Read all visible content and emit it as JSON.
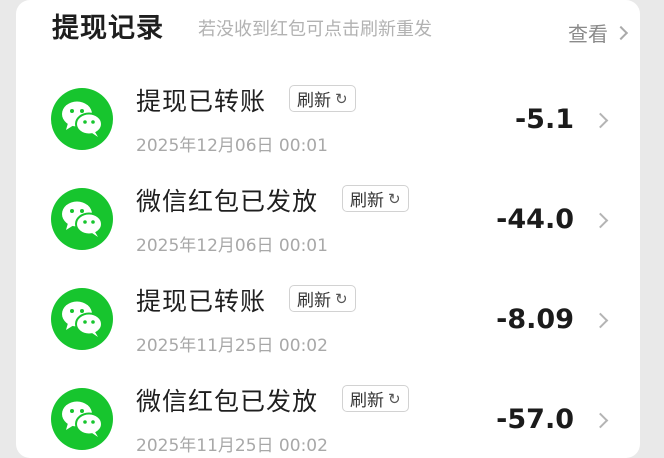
{
  "header": {
    "title": "提现记录",
    "subtitle": "若没收到红包可点击刷新重发",
    "view_label": "查看"
  },
  "records": [
    {
      "icon": "wechat-icon",
      "title": "提现已转账",
      "refresh_label": "刷新",
      "refresh_icon": "↻",
      "date": "2025年12月06日 00:01",
      "amount": "-5.1"
    },
    {
      "icon": "wechat-icon",
      "title": "微信红包已发放",
      "refresh_label": "刷新",
      "refresh_icon": "↻",
      "date": "2025年12月06日 00:01",
      "amount": "-44.0"
    },
    {
      "icon": "wechat-icon",
      "title": "提现已转账",
      "refresh_label": "刷新",
      "refresh_icon": "↻",
      "date": "2025年11月25日 00:02",
      "amount": "-8.09"
    },
    {
      "icon": "wechat-icon",
      "title": "微信红包已发放",
      "refresh_label": "刷新",
      "refresh_icon": "↻",
      "date": "2025年11月25日 00:02",
      "amount": "-57.0"
    }
  ],
  "colors": {
    "wechat_green": "#17c52e",
    "text_primary": "#1f1f1f",
    "text_secondary": "#a8a8a8"
  }
}
